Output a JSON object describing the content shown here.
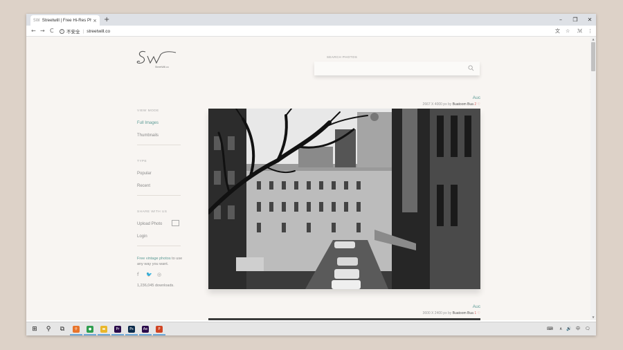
{
  "browser": {
    "tab_favicon": "SW",
    "tab_title": "Streetwill | Free Hi-Res Photos",
    "tab_close": "×",
    "new_tab": "+",
    "win_min": "–",
    "win_max": "❐",
    "win_close": "✕",
    "back": "←",
    "forward": "→",
    "reload": "C",
    "security_text": "不安全",
    "url": "streetwill.co",
    "translate_icon": "文",
    "star_icon": "☆",
    "ext_icon": "ℳ",
    "menu_icon": "⋮"
  },
  "site": {
    "logo_sub": "StreetWill.co",
    "search_label": "SEARCH PHOTOS",
    "search_placeholder": ""
  },
  "sidebar": {
    "view_mode_label": "VIEW MODE",
    "view_items": [
      "Full Images",
      "Thumbnails"
    ],
    "type_label": "TYPE",
    "type_items": [
      "Popular",
      "Recent"
    ],
    "share_label": "SHARE WITH US",
    "share_items": [
      "Upload Photo",
      "Login"
    ],
    "tagline_highlight": "Free vintage photos",
    "tagline_rest": " to use any way you want.",
    "social": [
      "f",
      "🐦",
      "◎"
    ],
    "downloads": "1,236,045 downloads."
  },
  "photos": [
    {
      "title": "Auc",
      "dims": "2667 X 4000 px",
      "by": "by",
      "author": "Buatoom Bua",
      "likes": "2 ♡"
    },
    {
      "title": "Auc",
      "dims": "3600 X 2400 px",
      "by": "by",
      "author": "Buatoom Bua",
      "likes": "1 ♡"
    }
  ],
  "taskbar": {
    "start": "⊞",
    "search": "⚲",
    "taskview": "⧉",
    "apps": [
      {
        "name": "search-app",
        "glyph": "⚲",
        "color": "#e8742b"
      },
      {
        "name": "chrome",
        "glyph": "●",
        "color": "#2f9e4f"
      },
      {
        "name": "file-explorer",
        "glyph": "▬",
        "color": "#e9b72b"
      },
      {
        "name": "premiere",
        "glyph": "Pr",
        "color": "#2a0a4a"
      },
      {
        "name": "photoshop",
        "glyph": "Ps",
        "color": "#0b2a4a"
      },
      {
        "name": "aftereffects",
        "glyph": "Ae",
        "color": "#2a0a4a"
      },
      {
        "name": "powerpoint",
        "glyph": "P",
        "color": "#d04423"
      }
    ],
    "tray_items": [
      "⌨",
      "∧",
      "🔊",
      "中",
      "🗨"
    ]
  }
}
